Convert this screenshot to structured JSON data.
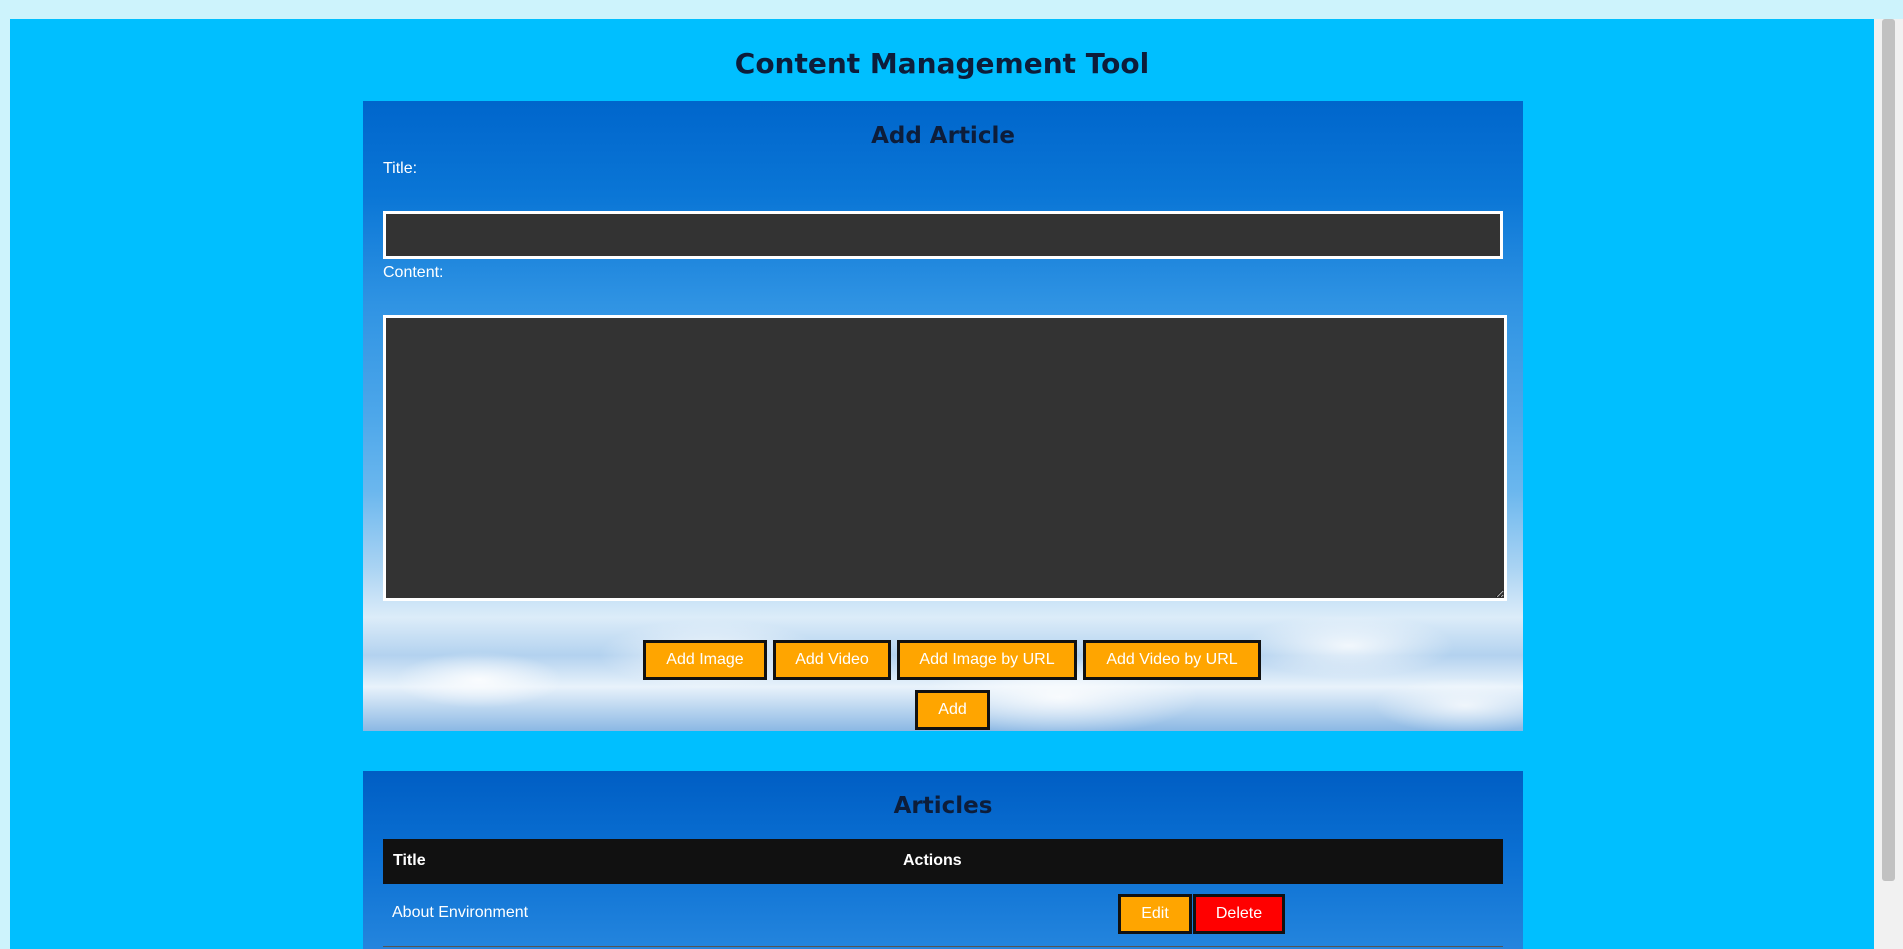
{
  "page": {
    "title": "Content Management Tool"
  },
  "add_article": {
    "heading": "Add Article",
    "title_label": "Title:",
    "title_value": "",
    "content_label": "Content:",
    "content_value": "",
    "buttons": {
      "add_image": "Add Image",
      "add_video": "Add Video",
      "add_image_url": "Add Image by URL",
      "add_video_url": "Add Video by URL",
      "add": "Add"
    }
  },
  "articles": {
    "heading": "Articles",
    "columns": [
      "Title",
      "Actions"
    ],
    "rows": [
      {
        "title": "About Environment",
        "edit_label": "Edit",
        "delete_label": "Delete"
      }
    ]
  },
  "colors": {
    "page_background": "#00bfff",
    "button_primary": "#ffa500",
    "button_danger": "#ff0000",
    "input_background": "#333333",
    "table_header": "#111111"
  }
}
